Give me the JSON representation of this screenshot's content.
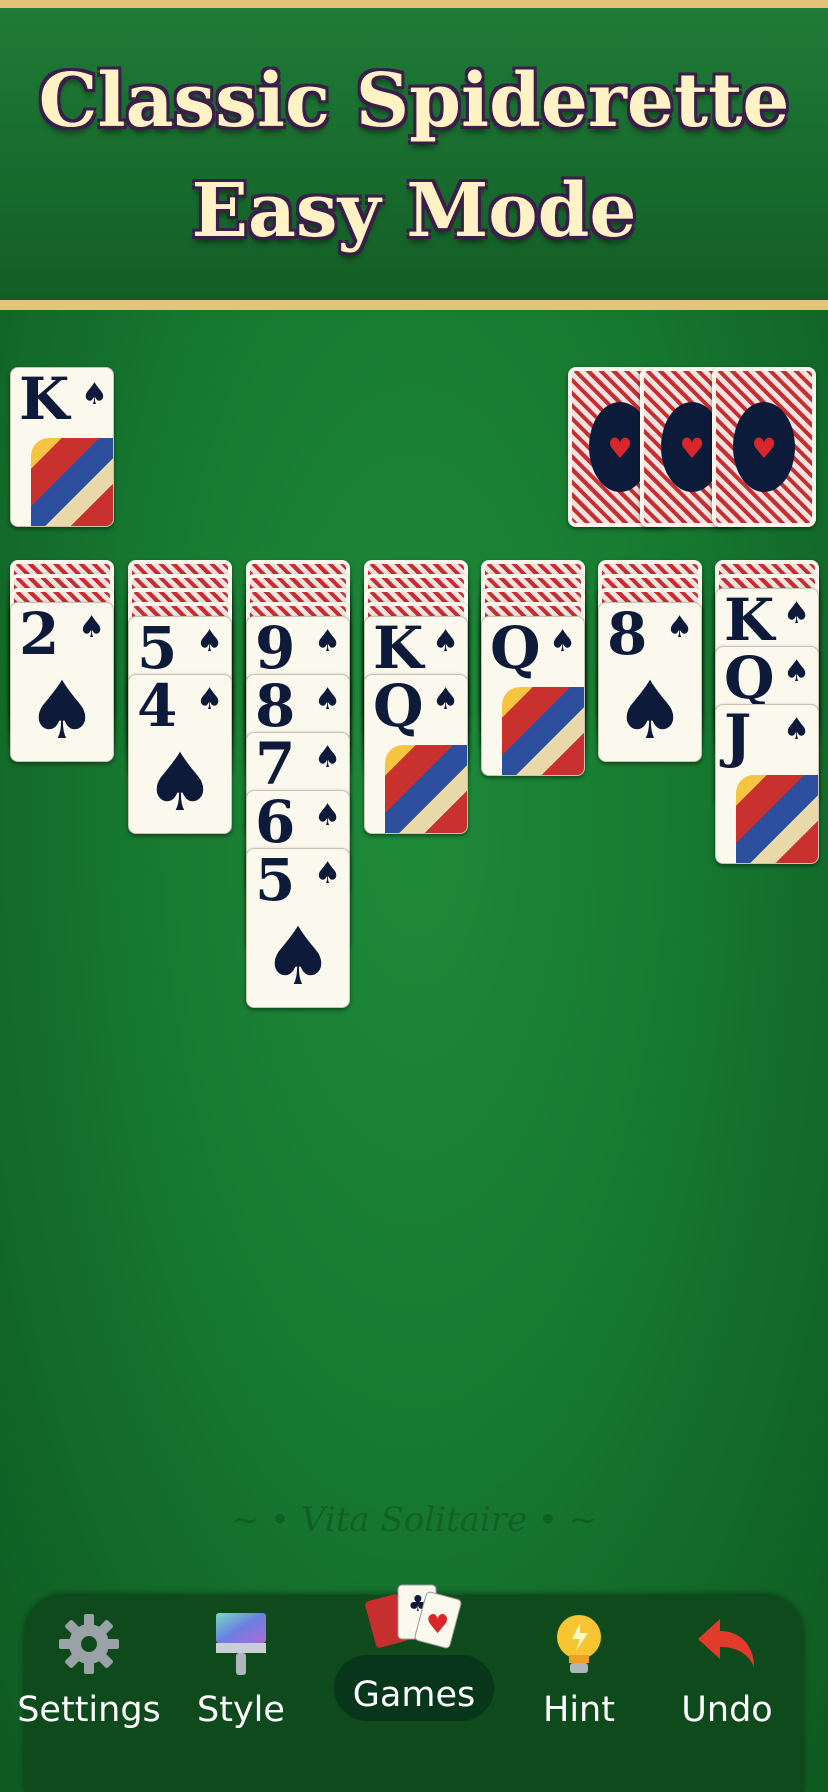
{
  "banner": {
    "line1": "Classic Spiderette",
    "line2": "Easy Mode"
  },
  "foundation": {
    "rank": "K",
    "suit": "♠"
  },
  "stock_count": 3,
  "tableau": [
    {
      "backs": 3,
      "cards": [
        {
          "rank": "2",
          "suit": "♠"
        }
      ]
    },
    {
      "backs": 4,
      "cards": [
        {
          "rank": "5",
          "suit": "♠"
        },
        {
          "rank": "4",
          "suit": "♠"
        }
      ]
    },
    {
      "backs": 4,
      "cards": [
        {
          "rank": "9",
          "suit": "♠"
        },
        {
          "rank": "8",
          "suit": "♠"
        },
        {
          "rank": "7",
          "suit": "♠"
        },
        {
          "rank": "6",
          "suit": "♠"
        },
        {
          "rank": "5",
          "suit": "♠"
        }
      ]
    },
    {
      "backs": 4,
      "cards": [
        {
          "rank": "K",
          "suit": "♠"
        },
        {
          "rank": "Q",
          "suit": "♠"
        }
      ]
    },
    {
      "backs": 4,
      "cards": [
        {
          "rank": "Q",
          "suit": "♠"
        }
      ]
    },
    {
      "backs": 3,
      "cards": [
        {
          "rank": "8",
          "suit": "♠"
        }
      ]
    },
    {
      "backs": 2,
      "cards": [
        {
          "rank": "K",
          "suit": "♠"
        },
        {
          "rank": "Q",
          "suit": "♠"
        },
        {
          "rank": "J",
          "suit": "♠"
        }
      ]
    }
  ],
  "watermark": "~ • Vita Solitaire • ~",
  "toolbar": {
    "settings": "Settings",
    "style": "Style",
    "games": "Games",
    "hint": "Hint",
    "undo": "Undo"
  },
  "icons": [
    "gear-icon",
    "paint-brush-icon",
    "cards-icon",
    "lightbulb-icon",
    "undo-arrow-icon"
  ],
  "colors": {
    "felt": "#177a30",
    "gold_border": "#e4c47a",
    "card_back_red": "#c72f2f",
    "navy": "#0e1a3a"
  }
}
